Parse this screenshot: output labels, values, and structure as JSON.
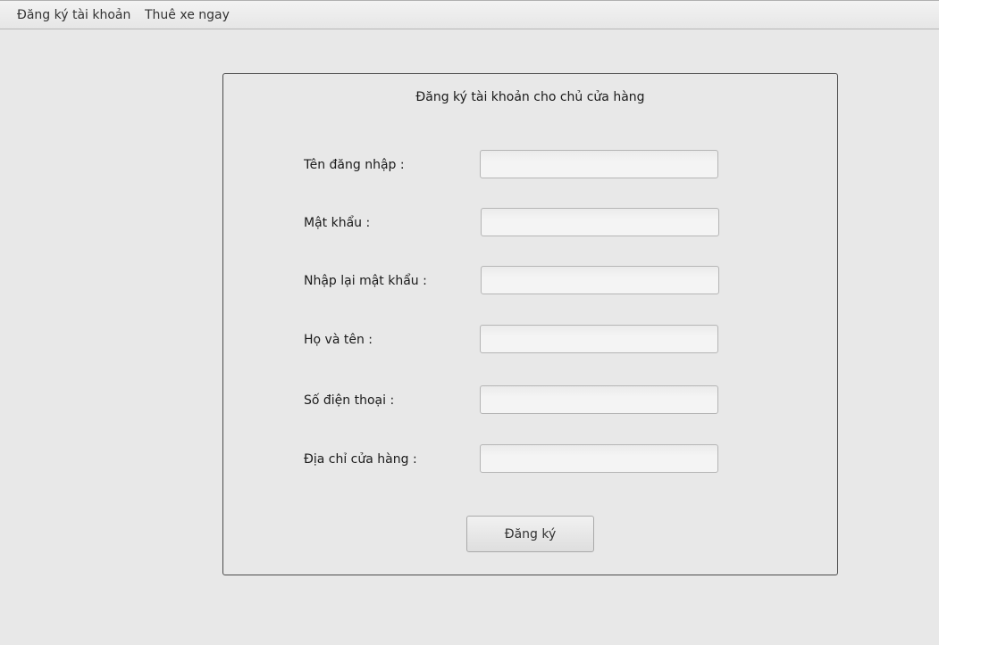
{
  "menu": {
    "items": [
      {
        "label": "Đăng ký tài khoản"
      },
      {
        "label": "Thuê xe ngay"
      }
    ]
  },
  "form": {
    "title": "Đăng ký tài khoản cho chủ cửa hàng",
    "fields": [
      {
        "label": "Tên đăng nhập :",
        "value": ""
      },
      {
        "label": "Mật khẩu :",
        "value": ""
      },
      {
        "label": "Nhập lại mật khẩu :",
        "value": ""
      },
      {
        "label": "Họ và tên :",
        "value": ""
      },
      {
        "label": "Số điện thoại :",
        "value": ""
      },
      {
        "label": "Địa chỉ cửa hàng :",
        "value": ""
      }
    ],
    "submit_label": "Đăng ký"
  }
}
